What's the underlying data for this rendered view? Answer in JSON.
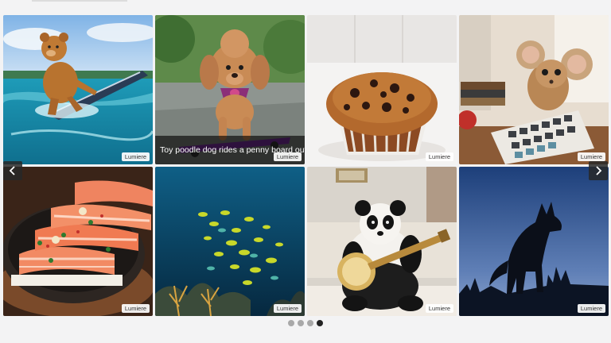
{
  "gallery": {
    "tiles": [
      {
        "badge": "Lumiere",
        "caption": ""
      },
      {
        "badge": "Lumiere",
        "caption": "Toy poodle dog rides a penny board outdoors"
      },
      {
        "badge": "Lumiere",
        "caption": ""
      },
      {
        "badge": "Lumiere",
        "caption": ""
      },
      {
        "badge": "Lumiere",
        "caption": ""
      },
      {
        "badge": "Lumiere",
        "caption": ""
      },
      {
        "badge": "Lumiere",
        "caption": ""
      },
      {
        "badge": "Lumiere",
        "caption": ""
      }
    ]
  },
  "navigation": {
    "prev_icon": "chevron-left-icon",
    "next_icon": "chevron-right-icon"
  },
  "pagination": {
    "page_count": 4,
    "active_page": 4
  },
  "colors": {
    "background": "#f3f3f4",
    "active_dot": "#222222",
    "inactive_dot": "#a8a8a8"
  }
}
